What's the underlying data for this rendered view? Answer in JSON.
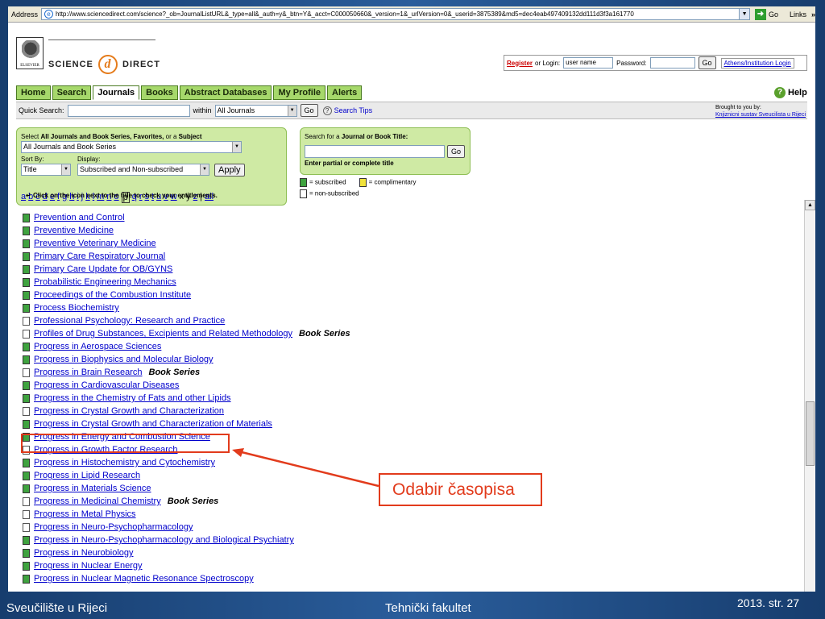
{
  "browser": {
    "address_label": "Address",
    "url": "http://www.sciencedirect.com/science?_ob=JournalListURL&_type=all&_auth=y&_btn=Y&_acct=C000050660&_version=1&_urlVersion=0&_userid=3875389&md5=dec4eab497409132dd111d3f3a161770",
    "go_label": "Go",
    "links_label": "Links",
    "links_chevron": "»"
  },
  "header": {
    "elsevier_caption": "ELSEVIER",
    "brand_left": "SCIENCE",
    "brand_at": "d",
    "brand_right": "DIRECT"
  },
  "login": {
    "register": "Register",
    "or_login": "or Login:",
    "username_value": "user name",
    "password_label": "Password:",
    "go_label": "Go",
    "athens_label": "Athens/Institution Login"
  },
  "nav": {
    "tabs": [
      {
        "label": "Home"
      },
      {
        "label": "Search"
      },
      {
        "label": "Journals"
      },
      {
        "label": "Books"
      },
      {
        "label": "Abstract Databases"
      },
      {
        "label": "My Profile"
      },
      {
        "label": "Alerts"
      }
    ],
    "help_label": "Help"
  },
  "quick_search": {
    "label": "Quick Search:",
    "within_label": "within",
    "within_value": "All Journals",
    "go_label": "Go",
    "tips_label": "Search Tips",
    "brought_by": "Brought to you by:",
    "brought_link": "Knjiznicni sustav Sveucilista u Rijeci"
  },
  "filter": {
    "select_label_pre": "Select ",
    "select_label_bold1": "All Journals and Book Series, Favorites,",
    "select_label_mid": " or a ",
    "select_label_bold2": "Subject",
    "select_value": "All Journals and Book Series",
    "sort_label": "Sort By:",
    "sort_value": "Title",
    "display_label": "Display:",
    "display_value": "Subscribed and Non-subscribed",
    "apply_label": "Apply",
    "letters": [
      "a",
      "b",
      "c",
      "d",
      "e",
      "f",
      "g",
      "h",
      "i",
      "j",
      "k",
      "l",
      "m",
      "n",
      "o",
      "p",
      "q",
      "r",
      "s",
      "t",
      "u",
      "v",
      "w",
      "x",
      "y",
      "z",
      "|",
      "all"
    ],
    "current_letter": "p",
    "plain_letters": [
      "x",
      "y",
      "|"
    ]
  },
  "title_search": {
    "label_pre": "Search for a ",
    "label_bold": "Journal or Book Title:",
    "go_label": "Go",
    "hint": "Enter partial or complete title"
  },
  "legend": {
    "subscribed": "= subscribed",
    "complimentary": "= complimentary",
    "non_subscribed": "= non-subscribed"
  },
  "click_note": "Click on the icon next to the title to check your entitlements.",
  "journals": [
    {
      "title": "Prevention and Control",
      "status": "green"
    },
    {
      "title": "Preventive Medicine",
      "status": "green"
    },
    {
      "title": "Preventive Veterinary Medicine",
      "status": "green"
    },
    {
      "title": "Primary Care Respiratory Journal",
      "status": "green"
    },
    {
      "title": "Primary Care Update for OB/GYNS",
      "status": "green"
    },
    {
      "title": "Probabilistic Engineering Mechanics",
      "status": "green"
    },
    {
      "title": "Proceedings of the Combustion Institute",
      "status": "green"
    },
    {
      "title": "Process Biochemistry",
      "status": "green"
    },
    {
      "title": "Professional Psychology: Research and Practice",
      "status": "white"
    },
    {
      "title": "Profiles of Drug Substances, Excipients and Related Methodology",
      "status": "white",
      "book_series": "Book Series"
    },
    {
      "title": "Progress in Aerospace Sciences",
      "status": "green"
    },
    {
      "title": "Progress in Biophysics and Molecular Biology",
      "status": "green"
    },
    {
      "title": "Progress in Brain Research",
      "status": "white",
      "book_series": "Book Series"
    },
    {
      "title": "Progress in Cardiovascular Diseases",
      "status": "green"
    },
    {
      "title": "Progress in the Chemistry of Fats and other Lipids",
      "status": "green"
    },
    {
      "title": "Progress in Crystal Growth and Characterization",
      "status": "white"
    },
    {
      "title": "Progress in Crystal Growth and Characterization of Materials",
      "status": "green"
    },
    {
      "title": "Progress in Energy and Combustion Science",
      "status": "green"
    },
    {
      "title": "Progress in Growth Factor Research",
      "status": "white"
    },
    {
      "title": "Progress in Histochemistry and Cytochemistry",
      "status": "green"
    },
    {
      "title": "Progress in Lipid Research",
      "status": "green"
    },
    {
      "title": "Progress in Materials Science",
      "status": "green"
    },
    {
      "title": "Progress in Medicinal Chemistry",
      "status": "white",
      "book_series": "Book Series"
    },
    {
      "title": "Progress in Metal Physics",
      "status": "white"
    },
    {
      "title": "Progress in Neuro-Psychopharmacology",
      "status": "white"
    },
    {
      "title": "Progress in Neuro-Psychopharmacology and Biological Psychiatry",
      "status": "green"
    },
    {
      "title": "Progress in Neurobiology",
      "status": "green"
    },
    {
      "title": "Progress in Nuclear Energy",
      "status": "green"
    },
    {
      "title": "Progress in Nuclear Magnetic Resonance Spectroscopy",
      "status": "green"
    }
  ],
  "annotation": {
    "callout_text": "Odabir časopisa",
    "color": "#e23b1c"
  },
  "footer": {
    "left": "Sveučilište u Rijeci",
    "center": "Tehnički fakultet",
    "right": "2013.  str. 27"
  },
  "colors": {
    "slide_bg": "#1d4a83",
    "tab_green": "#a6d86b",
    "panel_green": "#cfeaa4",
    "link_blue": "#0000cc",
    "subscribed_green": "#3fa33f",
    "complimentary_yellow": "#f0e23a"
  }
}
